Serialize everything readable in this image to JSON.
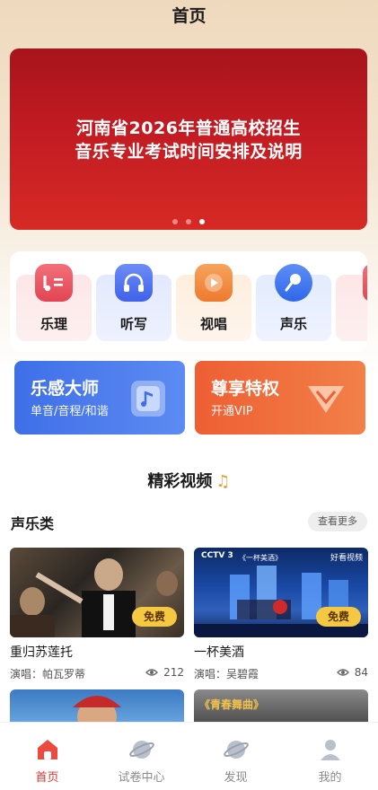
{
  "header": {
    "title": "首页"
  },
  "banner": {
    "line1": "河南省2026年普通高校招生",
    "line2": "音乐专业考试时间安排及说明",
    "page_count": 3,
    "active_index": 2
  },
  "categories": [
    {
      "label": "乐理",
      "icon": "music-theory-icon",
      "color": "#e9505a"
    },
    {
      "label": "听写",
      "icon": "headphones-icon",
      "color": "#4b6ff0"
    },
    {
      "label": "视唱",
      "icon": "play-icon",
      "color": "#f08a3a"
    },
    {
      "label": "声乐",
      "icon": "microphone-icon",
      "color": "#3d78f0"
    },
    {
      "label": "",
      "icon": "partial-category-icon",
      "color": "#e9505a"
    }
  ],
  "promos": [
    {
      "title": "乐感大师",
      "subtitle": "单音/音程/和谐",
      "icon": "music-note-icon",
      "color": "#4a78ea"
    },
    {
      "title": "尊享特权",
      "subtitle": "开通VIP",
      "icon": "vip-diamond-icon",
      "color": "#ee6a38"
    }
  ],
  "section": {
    "title": "精彩视频",
    "icon": "music-note-icon"
  },
  "category_section": {
    "title": "声乐类",
    "more_label": "查看更多"
  },
  "videos": [
    {
      "title": "重归苏莲托",
      "singer": "演唱：帕瓦罗蒂",
      "views": "212",
      "badge": "免费"
    },
    {
      "title": "一杯美酒",
      "singer": "演唱：吴碧霞",
      "views": "84",
      "badge": "免费"
    }
  ],
  "thumb_texts": {
    "tv_logo": "CCTV 3",
    "partner_logo": "好看视频",
    "stage_caption": "《一杯美酒》",
    "bottom_right_title": "《青春舞曲》"
  },
  "tabbar": [
    {
      "label": "首页",
      "icon": "home-icon",
      "active": true
    },
    {
      "label": "试卷中心",
      "icon": "planet-icon",
      "active": false
    },
    {
      "label": "发现",
      "icon": "discover-planet-icon",
      "active": false
    },
    {
      "label": "我的",
      "icon": "user-icon",
      "active": false
    }
  ],
  "colors": {
    "accent": "#e3342f",
    "badge": "#f5c842",
    "banner": "#c21b22"
  }
}
